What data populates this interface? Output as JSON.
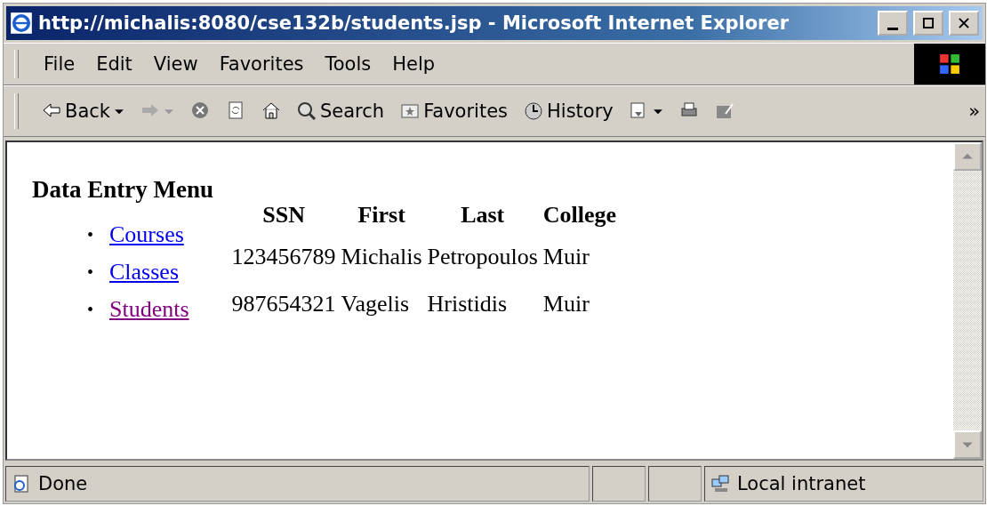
{
  "window": {
    "title": "http://michalis:8080/cse132b/students.jsp - Microsoft Internet Explorer"
  },
  "menu": [
    "File",
    "Edit",
    "View",
    "Favorites",
    "Tools",
    "Help"
  ],
  "toolbar": [
    {
      "kind": "back",
      "label": "Back",
      "disabled": false
    },
    {
      "kind": "forward",
      "disabled": true
    },
    {
      "kind": "stop"
    },
    {
      "kind": "refresh"
    },
    {
      "kind": "home"
    },
    {
      "kind": "search",
      "label": "Search"
    },
    {
      "kind": "favorites",
      "label": "Favorites"
    },
    {
      "kind": "history",
      "label": "History"
    },
    {
      "kind": "mail"
    },
    {
      "kind": "print"
    },
    {
      "kind": "edit"
    }
  ],
  "toolbar_more": "»",
  "page": {
    "heading": "Data Entry Menu",
    "links": [
      {
        "marker": "•",
        "label": "Courses",
        "visited": false
      },
      {
        "marker": "•",
        "label": "Classes",
        "visited": false
      },
      {
        "marker": "•",
        "label": "Students",
        "visited": true
      }
    ],
    "table": {
      "columns": [
        "SSN",
        "First",
        "Last",
        "College"
      ],
      "rows": [
        [
          "123456789",
          "Michalis",
          "Petropoulos",
          "Muir"
        ],
        [
          "987654321",
          "Vagelis",
          "Hristidis",
          "Muir"
        ]
      ]
    }
  },
  "status_bar": {
    "text": "Done",
    "zone": "Local intranet"
  }
}
